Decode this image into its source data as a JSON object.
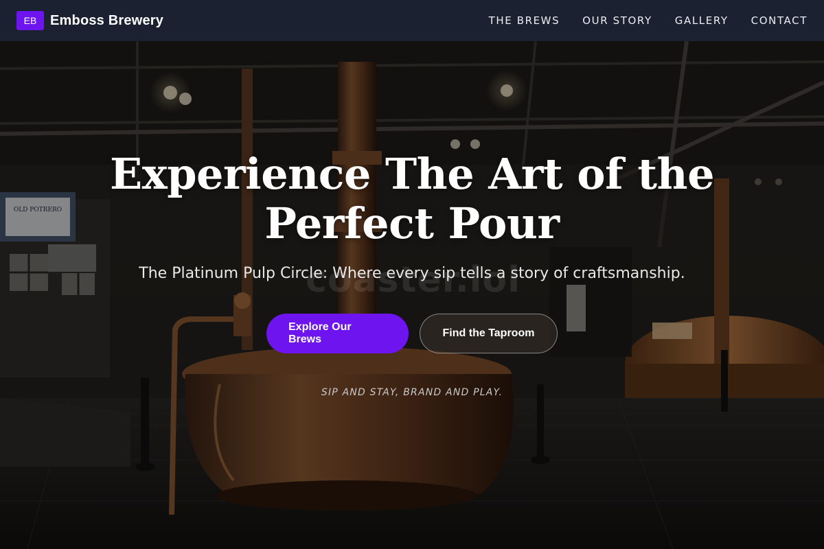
{
  "brand": {
    "badge": "EB",
    "name": "Emboss Brewery",
    "accent_color": "#6d14ef"
  },
  "nav": {
    "items": [
      {
        "label": "THE BREWS"
      },
      {
        "label": "OUR STORY"
      },
      {
        "label": "GALLERY"
      },
      {
        "label": "CONTACT"
      }
    ]
  },
  "hero": {
    "title": "Experience The Art of the Perfect Pour",
    "subtitle": "The Platinum Pulp Circle: Where every sip tells a story of craftsmanship.",
    "primary_cta": "Explore Our Brews",
    "secondary_cta": "Find the Taproom",
    "tagline": "Sip and stay, brand and play.",
    "background_watermark": "coaster.lol",
    "sign_text": "OLD POTRERO"
  },
  "colors": {
    "header_bg": "#1b2130",
    "primary_button": "#6d14ef",
    "copper": "#8a5a35"
  }
}
